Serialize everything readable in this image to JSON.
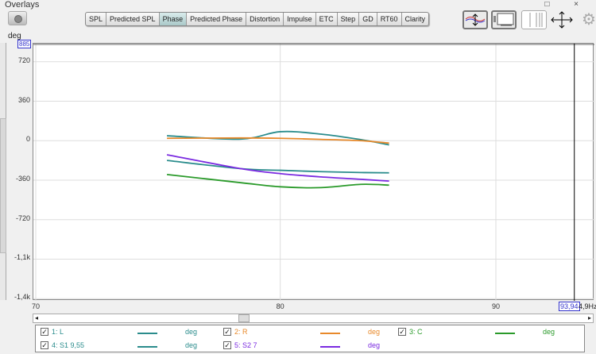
{
  "window": {
    "title": "Overlays",
    "buttons": "□ ×"
  },
  "tabs": [
    {
      "label": "SPL"
    },
    {
      "label": "Predicted SPL"
    },
    {
      "label": "Phase",
      "active": true
    },
    {
      "label": "Predicted Phase"
    },
    {
      "label": "Distortion"
    },
    {
      "label": "Impulse"
    },
    {
      "label": "ETC"
    },
    {
      "label": "Step"
    },
    {
      "label": "GD"
    },
    {
      "label": "RT60"
    },
    {
      "label": "Clarity"
    }
  ],
  "tools": [
    "trace-arrange-icon",
    "controls-layout-icon",
    "grid-lines-icon",
    "pan-arrows-icon",
    "gear-icon"
  ],
  "axis": {
    "y_unit": "deg",
    "y_max_box": "885",
    "cursor_box": "93,94",
    "x_end_label": "4,9Hz"
  },
  "chart_data": {
    "type": "line",
    "x_scale": "log",
    "xlim": [
      70,
      95.1
    ],
    "ylim": [
      -1460,
      885
    ],
    "x_ticks": [
      "70",
      "80",
      "90"
    ],
    "x_tick_values": [
      70,
      80,
      90
    ],
    "y_ticks": [
      "720",
      "360",
      "0",
      "-360",
      "-720",
      "-1,1k",
      "-1,4k"
    ],
    "y_tick_values": [
      720,
      360,
      0,
      -360,
      -720,
      -1080,
      -1440
    ],
    "ylabel": "deg",
    "grid": true,
    "cursor_x": 93.94,
    "series": [
      {
        "name": "1: L",
        "color": "#2a8c8c",
        "x": [
          75.2,
          78.3,
          80,
          81.8,
          83.6,
          84.9
        ],
        "y": [
          45,
          15,
          82,
          60,
          10,
          -38
        ]
      },
      {
        "name": "2: R",
        "color": "#e8892a",
        "x": [
          75.2,
          78.3,
          80,
          81.8,
          83.6,
          84.9
        ],
        "y": [
          22,
          25,
          22,
          12,
          0,
          -22
        ]
      },
      {
        "name": "3: C",
        "color": "#2a9a2a",
        "x": [
          75.2,
          78.3,
          80,
          81.8,
          83.6,
          84.9
        ],
        "y": [
          -308,
          -383,
          -420,
          -428,
          -398,
          -405
        ]
      },
      {
        "name": "4: S1 9,55",
        "color": "#2a8c8c",
        "x": [
          75.2,
          78.3,
          80,
          81.8,
          83.6,
          84.9
        ],
        "y": [
          -180,
          -255,
          -270,
          -282,
          -290,
          -293
        ]
      },
      {
        "name": "5: S2 7",
        "color": "#7a2ae0",
        "x": [
          75.2,
          78.3,
          80,
          81.8,
          83.6,
          84.9
        ],
        "y": [
          -128,
          -255,
          -300,
          -330,
          -352,
          -368
        ]
      }
    ]
  },
  "legend": [
    {
      "label": "1: L",
      "unit": "deg",
      "color": "#2a8c8c",
      "checked": "✓"
    },
    {
      "label": "2: R",
      "unit": "deg",
      "color": "#e8892a",
      "checked": "✓"
    },
    {
      "label": "3: C",
      "unit": "deg",
      "color": "#2a9a2a",
      "checked": "✓"
    },
    {
      "label": "4: S1 9,55",
      "unit": "deg",
      "color": "#2a8c8c",
      "checked": "✓"
    },
    {
      "label": "5: S2 7",
      "unit": "deg",
      "color": "#7a2ae0",
      "checked": "✓"
    }
  ]
}
